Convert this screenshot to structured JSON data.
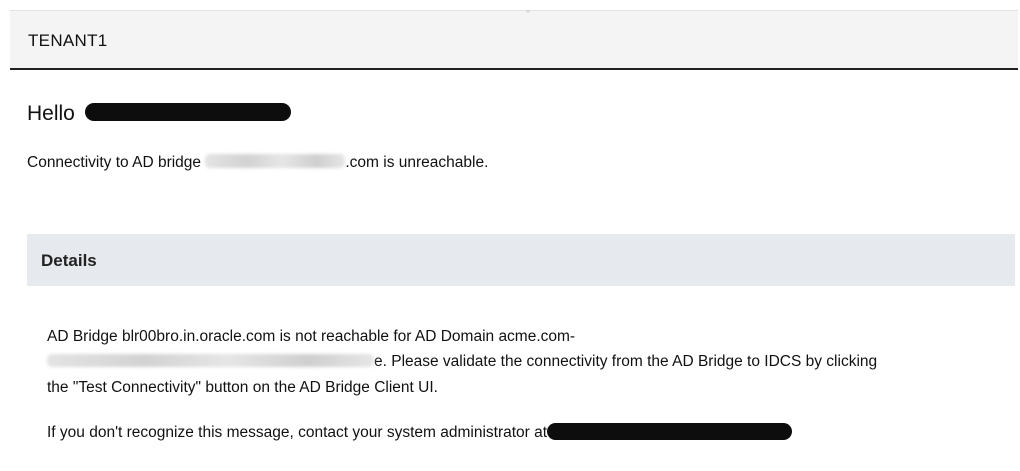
{
  "header": {
    "title": "TENANT1"
  },
  "message": {
    "greeting": "Hello",
    "connectivity_prefix": "Connectivity to AD bridge",
    "connectivity_suffix": ".com is unreachable."
  },
  "details": {
    "title": "Details",
    "line1": "AD Bridge blr00bro.in.oracle.com is not reachable for AD Domain acme.com-",
    "line2_suffix": "e. Please validate the connectivity from the AD Bridge to IDCS by clicking",
    "line3": "the \"Test Connectivity\" button on the AD Bridge Client UI.",
    "line4_prefix": "If you don't recognize this message, contact your system administrator at"
  },
  "colors": {
    "header_bg": "#f4f4f4",
    "header_border": "#222222",
    "details_bg": "#e6e9ed",
    "redaction": "#0d0d0d"
  }
}
